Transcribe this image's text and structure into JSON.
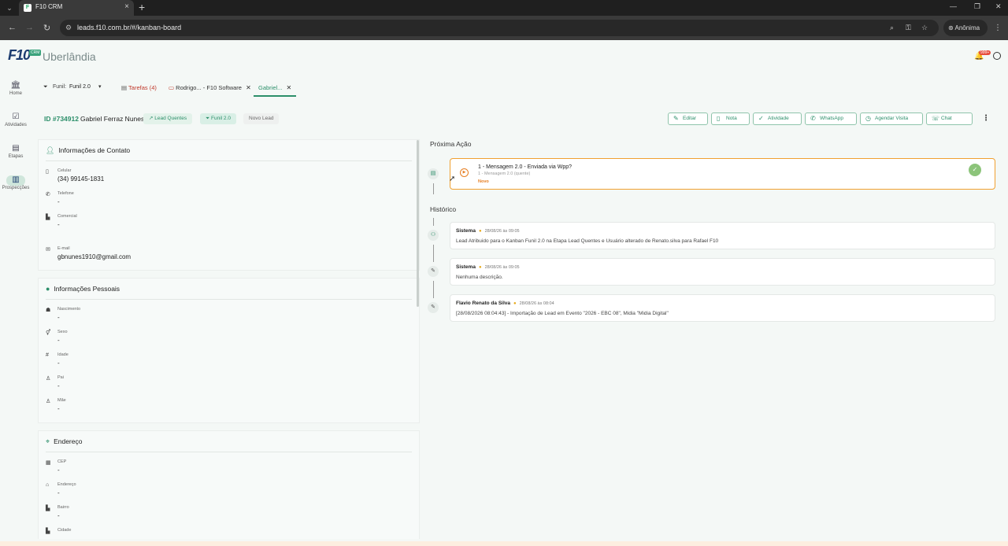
{
  "browser": {
    "tab_title": "F10 CRM",
    "tab_close": "×",
    "new_tab": "+",
    "url": "leads.f10.com.br/#/kanban-board",
    "profile_label": "Anônima",
    "win_min": "—",
    "win_max": "❐",
    "win_close": "✕"
  },
  "app": {
    "logo": "F10",
    "logo_badge": "CRM",
    "city": "Uberlândia",
    "notif_badge": "999+"
  },
  "sidebar": {
    "items": [
      {
        "label": "Home",
        "icon": "🏛"
      },
      {
        "label": "Atividades",
        "icon": "☑"
      },
      {
        "label": "Etapas",
        "icon": "▤"
      },
      {
        "label": "Prospecções",
        "icon": "▥"
      }
    ]
  },
  "workspace_tabs": {
    "funil_prefix": "Funil:",
    "funil_value": "Funil 2.0",
    "tarefas": "Tarefas (4)",
    "rodrigo": "Rodrigo... - F10 Software",
    "gabriel": "Gabriel..."
  },
  "lead": {
    "id": "ID #734912",
    "name": "Gabriel Ferraz Nunes",
    "chips": [
      "Lead Quentes",
      "Funil 2.0",
      "Novo Lead"
    ]
  },
  "actions": [
    "Editar",
    "Nota",
    "Atividade",
    "WhatsApp",
    "Agendar Visita",
    "Chat"
  ],
  "contact": {
    "title": "Informações de Contato",
    "fields": [
      {
        "label": "Celular",
        "value": "(34) 99145-1831"
      },
      {
        "label": "Telefone",
        "value": "-"
      },
      {
        "label": "Comercial",
        "value": "-"
      },
      {
        "label": "E-mail",
        "value": "gbnunes1910@gmail.com"
      }
    ]
  },
  "personal": {
    "title": "Informações Pessoais",
    "fields": [
      {
        "label": "Nascimento",
        "value": "-"
      },
      {
        "label": "Sexo",
        "value": "-"
      },
      {
        "label": "Idade",
        "value": "-"
      },
      {
        "label": "Pai",
        "value": "-"
      },
      {
        "label": "Mãe",
        "value": "-"
      }
    ]
  },
  "address": {
    "title": "Endereço",
    "fields": [
      {
        "label": "CEP",
        "value": "-"
      },
      {
        "label": "Endereço",
        "value": "-"
      },
      {
        "label": "Bairro",
        "value": "-"
      },
      {
        "label": "Cidade",
        "value": ""
      }
    ]
  },
  "next_action": {
    "section_title": "Próxima Ação",
    "title": "1 - Mensagem 2.0 - Enviada via Wpp?",
    "subtitle": "1 - Mensagem 2.0 (quente)",
    "status": "Novo"
  },
  "history": {
    "section_title": "Histórico",
    "items": [
      {
        "author": "Sistema",
        "date": "28/08/26 às 09:05",
        "text": "Lead Atribuido para o Kanban Funil 2.0 na Etapa Lead Quentes e Usuário alterado de Renato.silva para Rafael F10"
      },
      {
        "author": "Sistema",
        "date": "28/08/26 às 09:05",
        "text": "Nenhuma descrição."
      },
      {
        "author": "Flavio Renato da Silva",
        "date": "28/08/26 às 08:04",
        "text": "[28/08/2026 08:04:43] - Importação de Lead em Evento \"2026 - EBC 08\", Midia \"Midia Digital\""
      }
    ]
  }
}
